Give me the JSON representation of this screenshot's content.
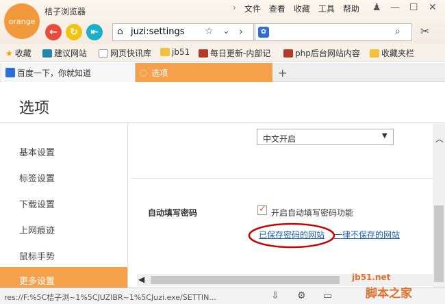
{
  "app": {
    "logo_text": "orange",
    "title": "桔子浏览器"
  },
  "menu": [
    {
      "label": "文件"
    },
    {
      "label": "查看"
    },
    {
      "label": "收藏"
    },
    {
      "label": "工具"
    },
    {
      "label": "帮助"
    }
  ],
  "address": {
    "value": "juzi:settings"
  },
  "bookmarks": [
    {
      "label": "收藏"
    },
    {
      "label": "建议网站"
    },
    {
      "label": "网页快讯库"
    },
    {
      "label": "jb51"
    },
    {
      "label": "每日更新-内部记"
    },
    {
      "label": "php后台网站内容"
    },
    {
      "label": "收藏夹栏"
    }
  ],
  "tabs": [
    {
      "label": "百度一下，你就知道"
    },
    {
      "label": "选项"
    }
  ],
  "page": {
    "title": "选项"
  },
  "sidebar": {
    "items": [
      {
        "label": "基本设置"
      },
      {
        "label": "标签设置"
      },
      {
        "label": "下载设置"
      },
      {
        "label": "上网痕迹"
      },
      {
        "label": "鼠标手势"
      },
      {
        "label": "更多设置"
      }
    ]
  },
  "settings": {
    "dropdown_value": "中文开启",
    "autofill_label": "自动填写密码",
    "autofill_checkbox_label": "开启自动填写密码功能",
    "saved_link": "已保存密码的网站",
    "never_link": "一律不保存的网站"
  },
  "status": {
    "text": "res://F:%5C桔子浏~1%5CJUZIBR~1%5CJuzi.exe/SETTIN..."
  },
  "watermark": {
    "text": "脚本之家",
    "url": "jb51.net"
  },
  "colors": {
    "accent": "#f5a04a",
    "logo": "#f29a3b",
    "link": "#1a5fb4",
    "annotation": "#cc0000"
  }
}
